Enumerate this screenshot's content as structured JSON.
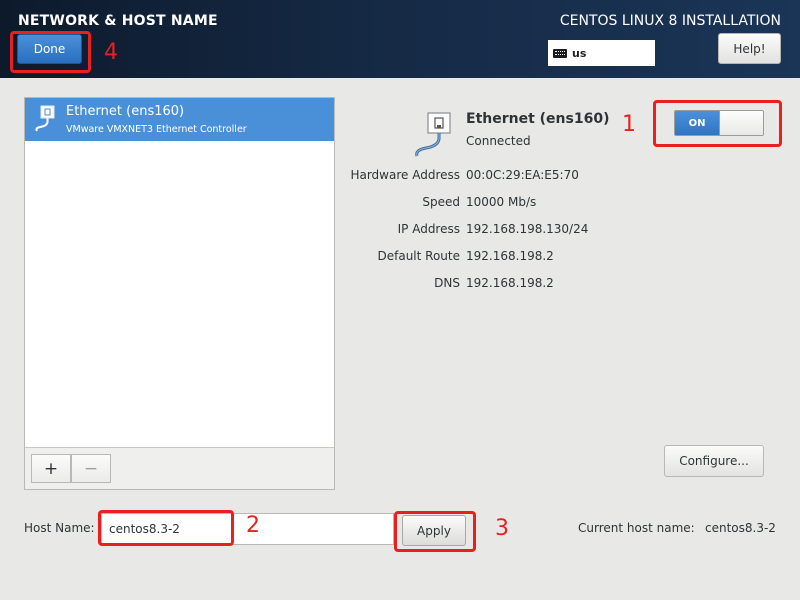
{
  "header": {
    "spoke_title": "NETWORK & HOST NAME",
    "product_title": "CENTOS LINUX 8 INSTALLATION",
    "done_label": "Done",
    "keyboard_layout": "us",
    "help_label": "Help!"
  },
  "device_list": {
    "items": [
      {
        "name": "Ethernet (ens160)",
        "description": "VMware VMXNET3 Ethernet Controller",
        "selected": true
      }
    ],
    "add_label": "+",
    "remove_label": "−"
  },
  "device_detail": {
    "name": "Ethernet (ens160)",
    "status": "Connected",
    "toggle_label": "ON",
    "toggle_state": "on",
    "fields": [
      {
        "label": "Hardware Address",
        "value": "00:0C:29:EA:E5:70"
      },
      {
        "label": "Speed",
        "value": "10000 Mb/s"
      },
      {
        "label": "IP Address",
        "value": "192.168.198.130/24"
      },
      {
        "label": "Default Route",
        "value": "192.168.198.2"
      },
      {
        "label": "DNS",
        "value": "192.168.198.2"
      }
    ],
    "configure_label": "Configure..."
  },
  "hostname": {
    "label": "Host Name:",
    "value": "centos8.3-2",
    "apply_label": "Apply",
    "current_label": "Current host name:",
    "current_value": "centos8.3-2"
  },
  "annotations": [
    "1",
    "2",
    "3",
    "4"
  ],
  "colors": {
    "header_bg": "#152944",
    "accent": "#4a90d9",
    "annotation": "#e8201f"
  }
}
